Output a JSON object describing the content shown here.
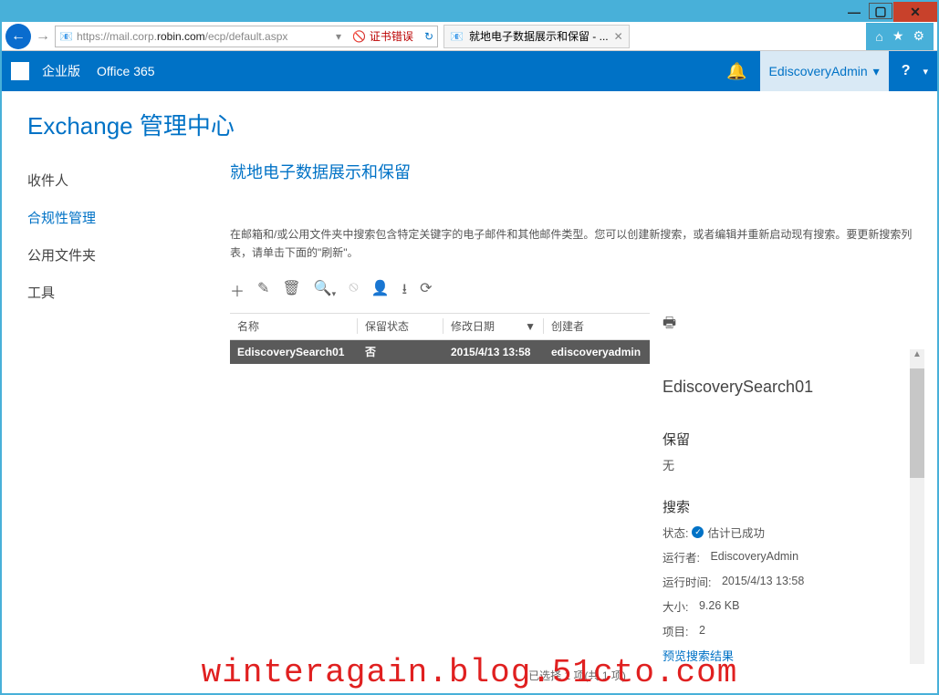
{
  "window": {
    "url_prefix": "https://mail.corp.",
    "url_domain": "robin.com",
    "url_suffix": "/ecp/default.aspx",
    "cert_error": "证书错误",
    "tab_title": "就地电子数据展示和保留 - ..."
  },
  "o365": {
    "enterprise": "企业版",
    "product": "Office 365",
    "user": "EdiscoveryAdmin"
  },
  "eac": {
    "title": "Exchange 管理中心",
    "nav": {
      "recipients": "收件人",
      "compliance": "合规性管理",
      "public_folders": "公用文件夹",
      "tools": "工具"
    },
    "section_title": "就地电子数据展示和保留",
    "help_text": "在邮箱和/或公用文件夹中搜索包含特定关键字的电子邮件和其他邮件类型。您可以创建新搜索，或者编辑并重新启动现有搜索。要更新搜索列表，请单击下面的\"刷新\"。"
  },
  "table": {
    "headers": {
      "name": "名称",
      "hold": "保留状态",
      "modified": "修改日期",
      "creator": "创建者"
    },
    "row": {
      "name": "EdiscoverySearch01",
      "hold": "否",
      "modified": "2015/4/13 13:58",
      "creator": "ediscoveryadmin"
    }
  },
  "details": {
    "title": "EdiscoverySearch01",
    "hold_label": "保留",
    "hold_value": "无",
    "search_label": "搜索",
    "status_label": "状态:",
    "status_value": "估计已成功",
    "runner_label": "运行者:",
    "runner_value": "EdiscoveryAdmin",
    "runtime_label": "运行时间:",
    "runtime_value": "2015/4/13 13:58",
    "size_label": "大小:",
    "size_value": "9.26 KB",
    "items_label": "项目:",
    "items_value": "2",
    "preview_link": "预览搜索结果"
  },
  "footer": "已选择 1 项(共 1 项)",
  "watermark": "winteragain.blog.51cto.com"
}
